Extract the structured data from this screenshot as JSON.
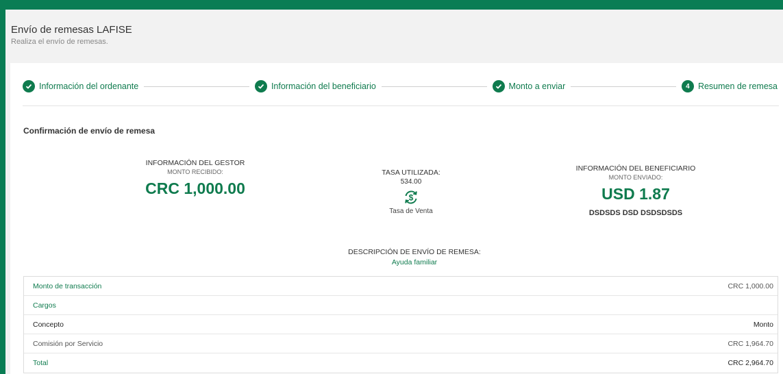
{
  "header": {
    "title": "Envío de remesas LAFISE",
    "subtitle": "Realiza el envío de remesas."
  },
  "stepper": {
    "steps": [
      {
        "label": "Información del ordenante",
        "icon": "check-icon",
        "state": "completed"
      },
      {
        "label": "Información del beneficiario",
        "icon": "check-icon",
        "state": "completed"
      },
      {
        "label": "Monto a enviar",
        "icon": "check-icon",
        "state": "completed"
      },
      {
        "label": "Resumen de remesa",
        "number": "4",
        "state": "current"
      }
    ]
  },
  "confirmation": {
    "title": "Confirmación de envío de remesa",
    "gestor": {
      "heading": "INFORMACIÓN DEL GESTOR",
      "sub": "MONTO RECIBIDO:",
      "amount": "CRC 1,000.00"
    },
    "rate": {
      "heading": "TASA UTILIZADA:",
      "value": "534.00",
      "icon": "currency-exchange-icon",
      "caption": "Tasa de Venta"
    },
    "beneficiary": {
      "heading": "INFORMACIÓN DEL BENEFICIARIO",
      "sub": "MONTO ENVIADO:",
      "amount": "USD 1.87",
      "name": "DSDSDS DSD DSDSDSDS"
    },
    "description": {
      "heading": "DESCRIPCIÓN DE ENVÍO DE REMESA:",
      "value": "Ayuda familiar"
    }
  },
  "table": {
    "rows": [
      {
        "label": "Monto de transacción",
        "value": "CRC 1,000.00"
      },
      {
        "label": "Cargos",
        "value": ""
      },
      {
        "label": "Concepto",
        "value": "Monto"
      },
      {
        "label": "Comisión por Servicio",
        "value": "CRC 1,964.70"
      },
      {
        "label": "Total",
        "value": "CRC 2,964.70"
      }
    ]
  },
  "colors": {
    "brand": "#0a7d54",
    "accent": "#0f7b4e"
  }
}
